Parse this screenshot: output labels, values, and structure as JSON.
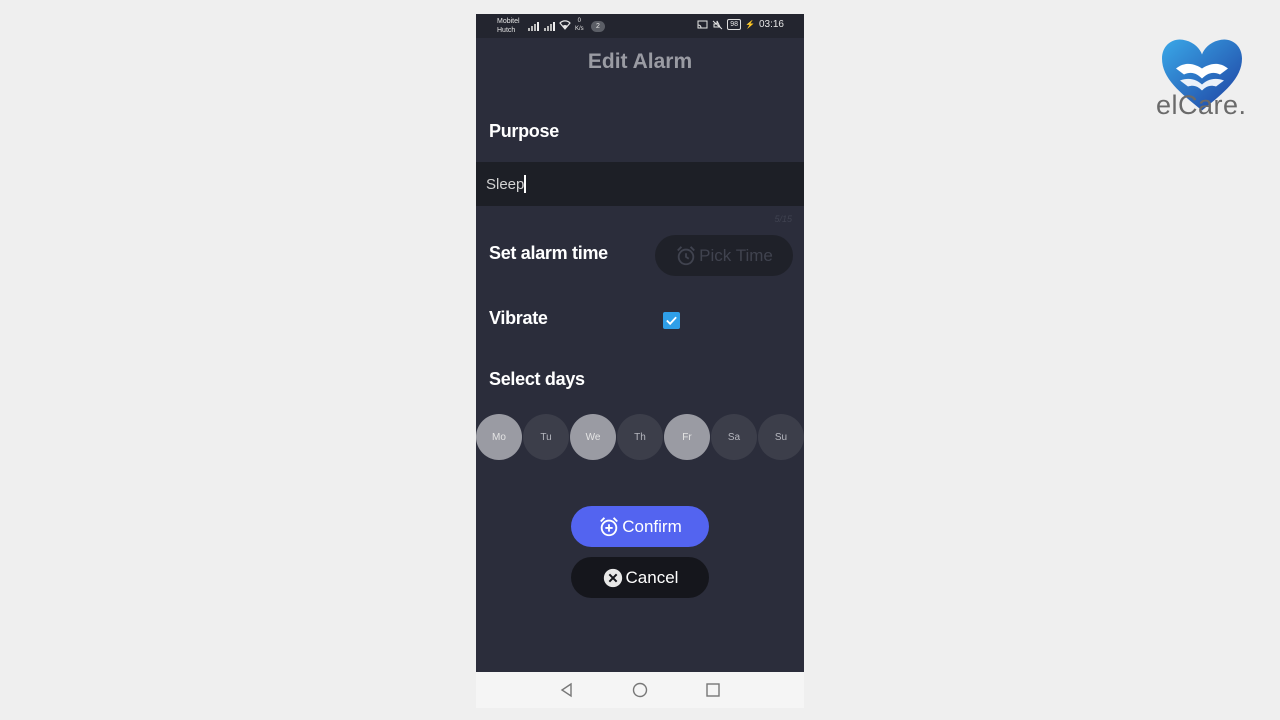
{
  "status_bar": {
    "carrier_1": "Mobitel",
    "carrier_2": "Hutch",
    "speed_value": "0",
    "speed_unit": "K/s",
    "notification_count": "2",
    "battery": "98",
    "time": "03:16"
  },
  "screen": {
    "title": "Edit Alarm",
    "purpose_label": "Purpose",
    "purpose_value": "Sleep",
    "char_counter": "5/15",
    "alarm_time_label": "Set alarm time",
    "pick_time_label": "Pick Time",
    "vibrate_label": "Vibrate",
    "vibrate_checked": true,
    "select_days_label": "Select days",
    "days": [
      {
        "label": "Mo",
        "selected": true
      },
      {
        "label": "Tu",
        "selected": false
      },
      {
        "label": "We",
        "selected": true
      },
      {
        "label": "Th",
        "selected": false
      },
      {
        "label": "Fr",
        "selected": true
      },
      {
        "label": "Sa",
        "selected": false
      },
      {
        "label": "Su",
        "selected": false
      }
    ],
    "confirm_label": "Confirm",
    "cancel_label": "Cancel"
  },
  "icons": {
    "pick_time": "alarm-clock-icon",
    "confirm": "alarm-add-icon",
    "cancel": "close-circle-icon",
    "checkbox": "check-icon",
    "nav_back": "triangle-back-icon",
    "nav_home": "circle-home-icon",
    "nav_recents": "square-recents-icon"
  },
  "colors": {
    "background": "#2b2d3b",
    "accent": "#5364f0",
    "checkbox": "#2f9fe8",
    "day_selected": "#9a9ba3",
    "day_unselected": "#3c3e4a"
  },
  "branding": {
    "logo_text": "elCare."
  }
}
